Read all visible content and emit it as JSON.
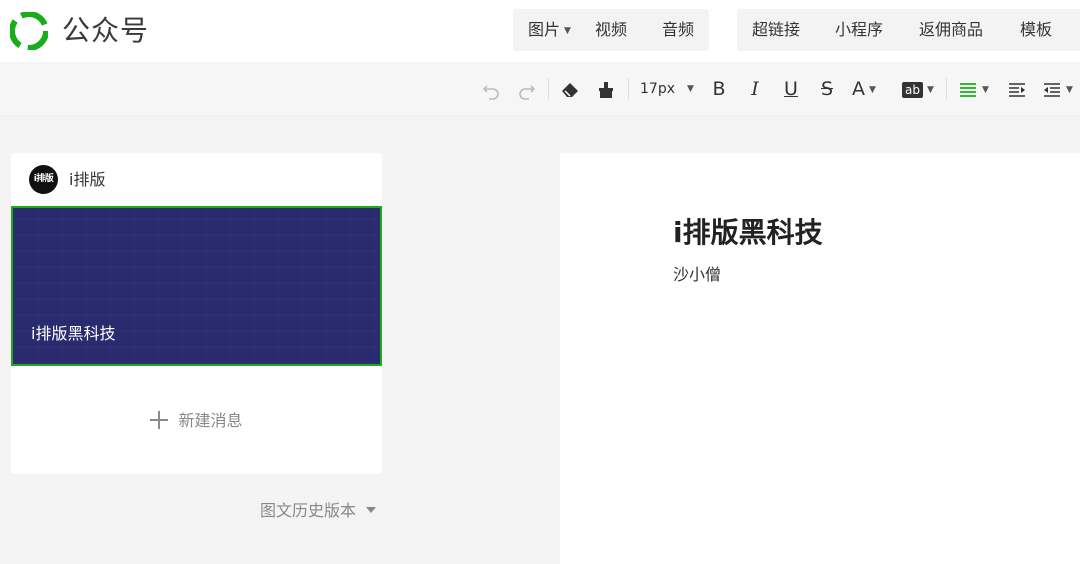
{
  "header": {
    "brand": "公众号",
    "media_menu": [
      {
        "label": "图片",
        "has_dropdown": true
      },
      {
        "label": "视频"
      },
      {
        "label": "音频"
      }
    ],
    "insert_menu": [
      {
        "label": "超链接"
      },
      {
        "label": "小程序"
      },
      {
        "label": "返佣商品"
      },
      {
        "label": "模板"
      }
    ]
  },
  "toolbar": {
    "font_size": "17px",
    "buttons": [
      "undo-icon",
      "redo-icon",
      "eraser-icon",
      "format-painter-icon",
      "bold-icon",
      "italic-icon",
      "underline-icon",
      "strikethrough-icon",
      "font-color-icon",
      "highlight-icon",
      "align-icon",
      "indent-icon",
      "outdent-icon"
    ],
    "bold_glyph": "B",
    "italic_glyph": "I",
    "underline_glyph": "U",
    "strike_glyph": "S",
    "font_color_glyph": "A",
    "highlight_glyph": "ab",
    "accent_color": "#1aad19"
  },
  "sidebar": {
    "account_name": "i排版",
    "avatar_text": "i排版",
    "article": {
      "title": "i排版黑科技",
      "cover_color": "#2a2a6e",
      "selected": true
    },
    "new_message_label": "新建消息",
    "history_label": "图文历史版本"
  },
  "editor": {
    "title": "i排版黑科技",
    "author": "沙小僧"
  }
}
